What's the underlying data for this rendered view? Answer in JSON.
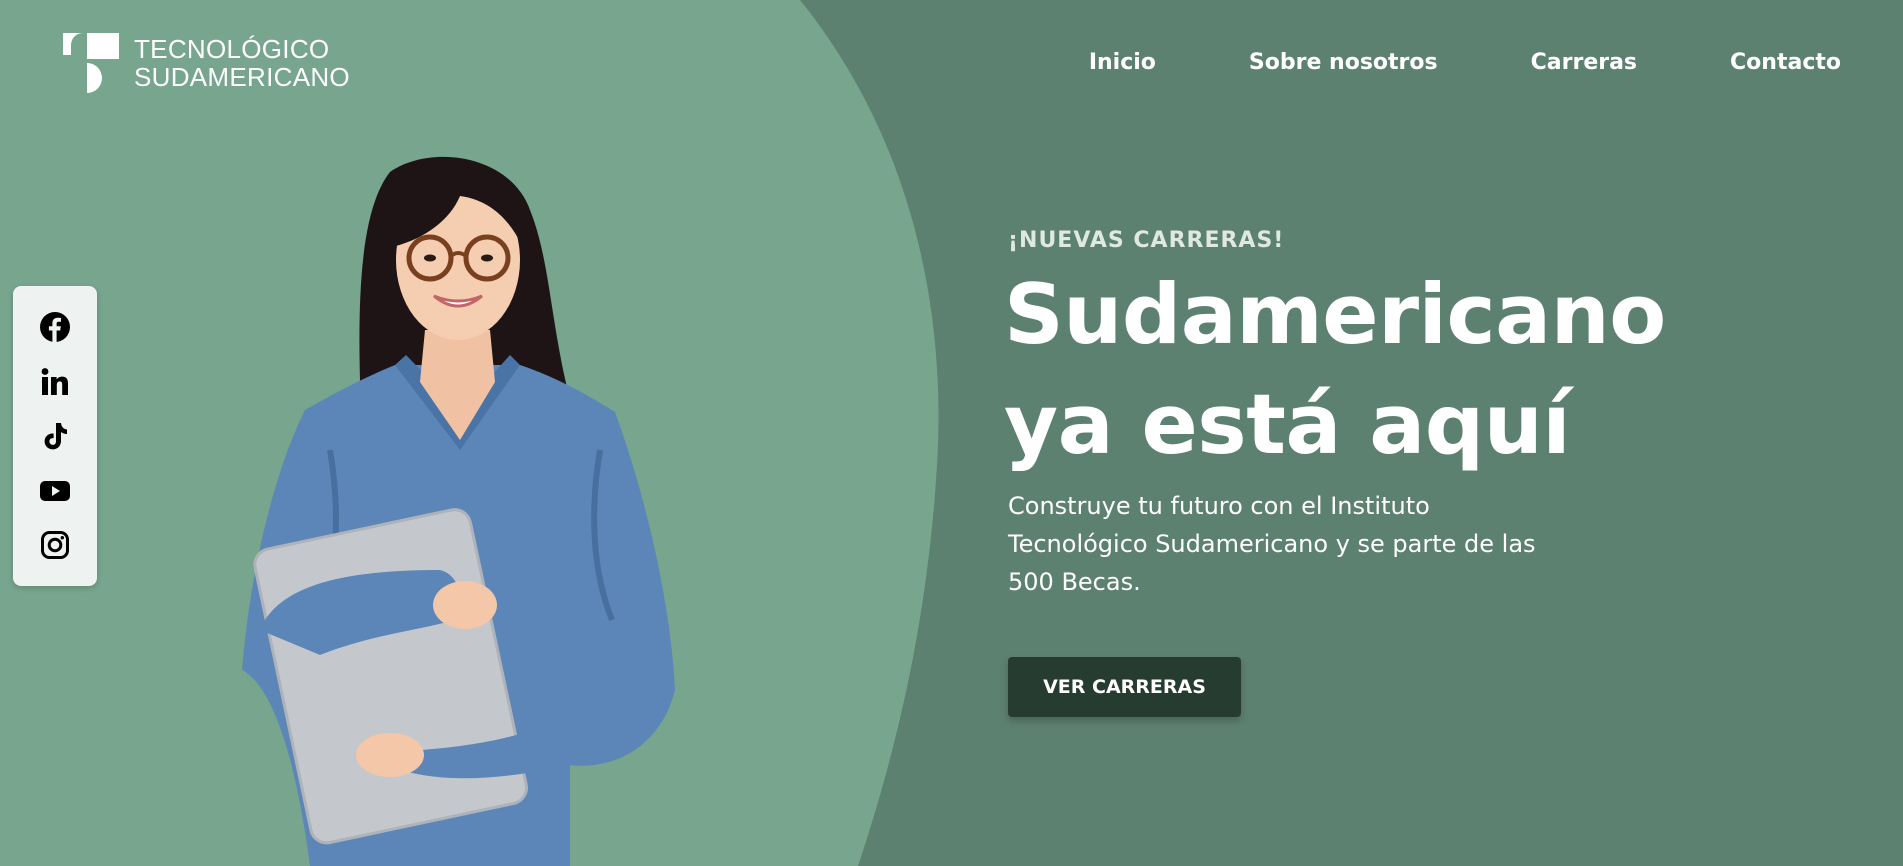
{
  "brand": {
    "line1": "TECNOLÓGICO",
    "line2": "SUDAMERICANO"
  },
  "nav": {
    "items": [
      {
        "label": "Inicio"
      },
      {
        "label": "Sobre nosotros"
      },
      {
        "label": "Carreras"
      },
      {
        "label": "Contacto"
      }
    ]
  },
  "social": [
    "facebook-icon",
    "linkedin-icon",
    "tiktok-icon",
    "youtube-icon",
    "instagram-icon"
  ],
  "hero": {
    "eyebrow": "¡NUEVAS CARRERAS!",
    "headline_line1": "Sudamericano",
    "headline_line2": "ya está aquí",
    "description": "Construye tu futuro con el Instituto Tecnológico Sudamericano y se parte de las 500 Becas.",
    "cta_label": "VER CARRERAS"
  },
  "colors": {
    "background": "#5d8170",
    "curve": "#77a58d",
    "button": "#263c30",
    "social_panel": "#eef2f0",
    "text": "#ffffff"
  }
}
